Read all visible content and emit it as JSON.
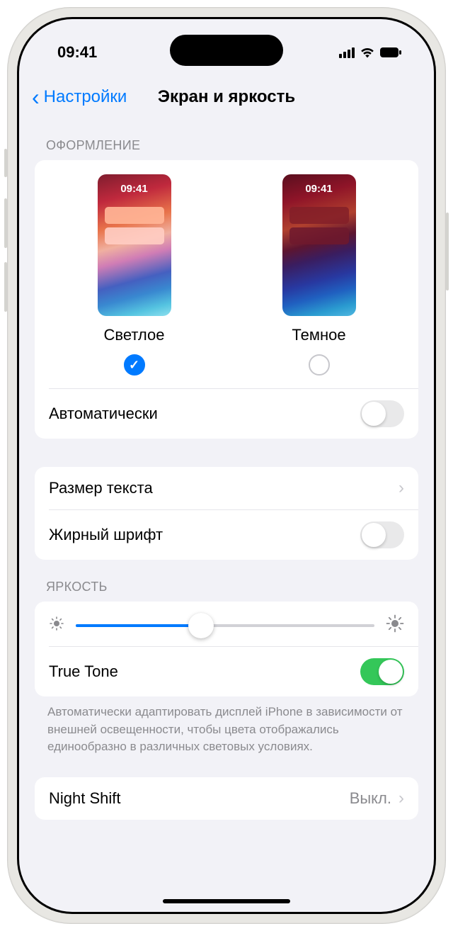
{
  "status": {
    "time": "09:41"
  },
  "nav": {
    "back_label": "Настройки",
    "title": "Экран и яркость"
  },
  "appearance": {
    "header": "Оформление",
    "options": [
      {
        "label": "Светлое",
        "time": "09:41",
        "selected": true
      },
      {
        "label": "Темное",
        "time": "09:41",
        "selected": false
      }
    ],
    "automatic": {
      "label": "Автоматически",
      "on": false
    }
  },
  "text": {
    "size_label": "Размер текста",
    "bold": {
      "label": "Жирный шрифт",
      "on": false
    }
  },
  "brightness": {
    "header": "Яркость",
    "value_percent": 42,
    "truetone": {
      "label": "True Tone",
      "on": true
    },
    "footer": "Автоматически адаптировать дисплей iPhone в зависимости от внешней освещенности, чтобы цвета отображались единообразно в различных световых условиях."
  },
  "nightshift": {
    "label": "Night Shift",
    "value": "Выкл."
  }
}
